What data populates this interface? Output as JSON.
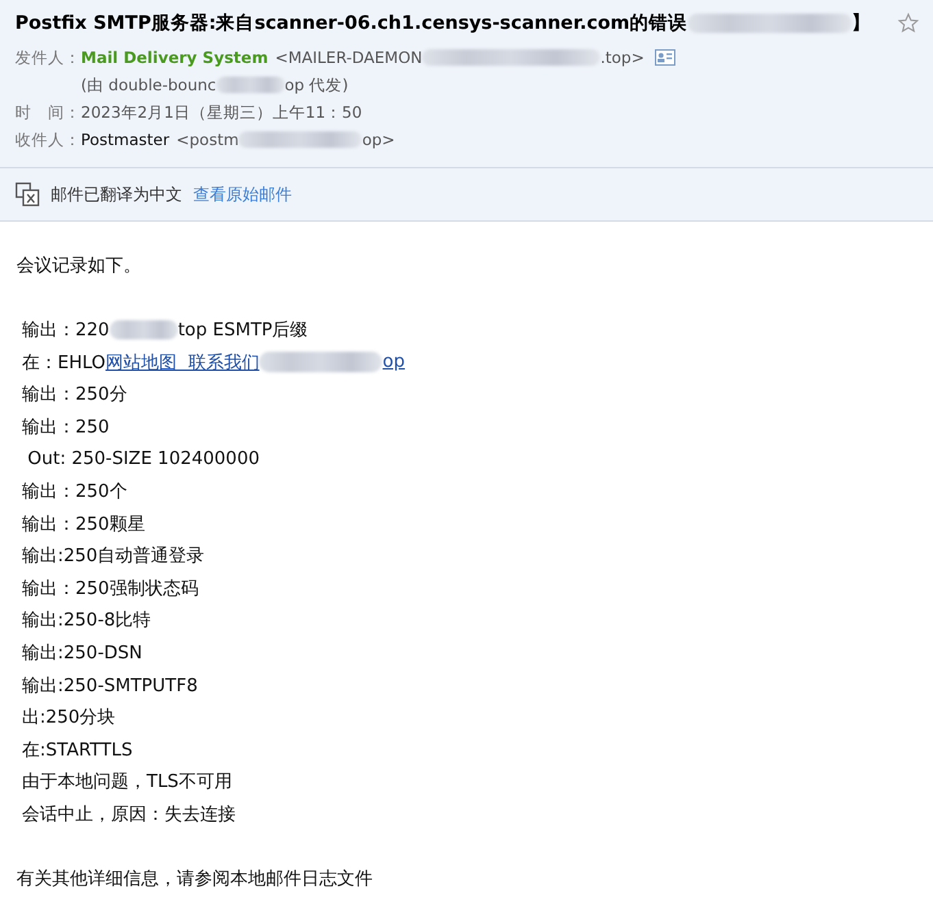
{
  "header": {
    "title": [
      {
        "kind": "text",
        "text": "Postfix SMTP服务器:来自scanner-06.ch1.censys-scanner.com的错误"
      },
      {
        "kind": "redacted"
      },
      {
        "kind": "text",
        "text": "】"
      }
    ],
    "starred": false,
    "fields": [
      {
        "label": "发件人：",
        "name": "Mail Delivery System",
        "value": [
          {
            "kind": "text",
            "text": "<MAILER-DAEMON"
          },
          {
            "kind": "redacted"
          },
          {
            "kind": "text",
            "text": ".top>"
          },
          {
            "kind": "card_icon"
          }
        ]
      },
      {
        "value": [
          {
            "kind": "text",
            "text": "(由 double-bounc"
          },
          {
            "kind": "redacted"
          },
          {
            "kind": "text",
            "text": "op 代发)"
          }
        ]
      },
      {
        "label": "时　间：",
        "value": [
          {
            "kind": "text",
            "text": "2023年2月1日（星期三）上午11：50"
          }
        ]
      },
      {
        "label": "收件人：",
        "name_plain": "Postmaster",
        "value": [
          {
            "kind": "text",
            "text": "<postm"
          },
          {
            "kind": "redacted"
          },
          {
            "kind": "text",
            "text": "op>"
          }
        ]
      }
    ]
  },
  "translation": {
    "notice": "邮件已翻译为中文",
    "link": "查看原始邮件"
  },
  "body": {
    "intro": "会议记录如下。",
    "lines": [
      [
        {
          "kind": "text",
          "text": "输出：220"
        },
        {
          "kind": "redacted"
        },
        {
          "kind": "text",
          "text": "top ESMTP后缀"
        }
      ],
      [
        {
          "kind": "text",
          "text": "在：EHLO"
        },
        {
          "kind": "link",
          "text": "网站地图  联系我们"
        },
        {
          "kind": "redacted"
        },
        {
          "kind": "link",
          "text": "op"
        }
      ],
      [
        {
          "kind": "text",
          "text": "输出：250分"
        }
      ],
      [
        {
          "kind": "text",
          "text": "输出：250"
        }
      ],
      [
        {
          "kind": "text",
          "text": " Out: 250-SIZE 102400000"
        }
      ],
      [
        {
          "kind": "text",
          "text": "输出：250个"
        }
      ],
      [
        {
          "kind": "text",
          "text": "输出：250颗星"
        }
      ],
      [
        {
          "kind": "text",
          "text": "输出:250自动普通登录"
        }
      ],
      [
        {
          "kind": "text",
          "text": "输出：250强制状态码"
        }
      ],
      [
        {
          "kind": "text",
          "text": "输出:250-8比特"
        }
      ],
      [
        {
          "kind": "text",
          "text": "输出:250-DSN"
        }
      ],
      [
        {
          "kind": "text",
          "text": "输出:250-SMTPUTF8"
        }
      ],
      [
        {
          "kind": "text",
          "text": "出:250分块"
        }
      ],
      [
        {
          "kind": "text",
          "text": "在:STARTTLS"
        }
      ],
      [
        {
          "kind": "text",
          "text": "由于本地问题，TLS不可用"
        }
      ],
      [
        {
          "kind": "text",
          "text": "会话中止，原因：失去连接"
        }
      ]
    ],
    "footer": "有关其他详细信息，请参阅本地邮件日志文件"
  }
}
